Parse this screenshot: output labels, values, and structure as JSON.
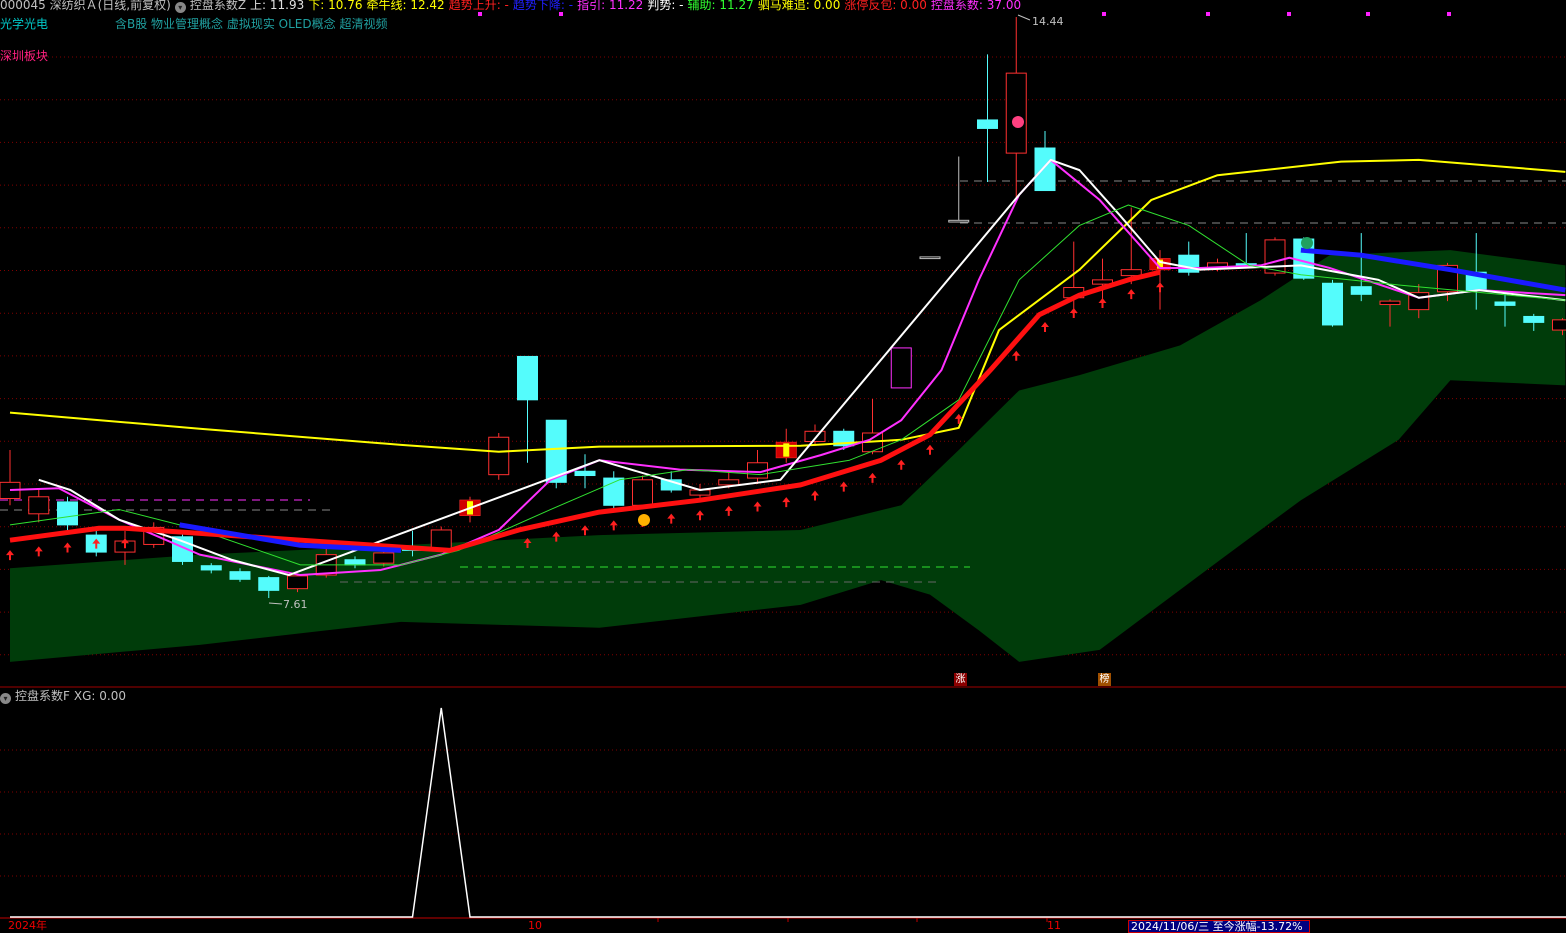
{
  "header": {
    "stock_code_name": "000045 深纺织Ａ",
    "period": "(日线,前复权)",
    "indicator_name": "控盘系数Z",
    "values": [
      {
        "label": "上: 11.93",
        "color": "#e0e0e0"
      },
      {
        "label": "下: 10.76",
        "color": "#ffff00"
      },
      {
        "label": "牵牛线: 12.42",
        "color": "#ffff00"
      },
      {
        "label": "趋势上升: -",
        "color": "#ff2020"
      },
      {
        "label": "趋势下降: -",
        "color": "#2020ff"
      },
      {
        "label": "指引: 11.22",
        "color": "#ff30ff"
      },
      {
        "label": "判势: -",
        "color": "#ffffff"
      },
      {
        "label": "辅助: 11.27",
        "color": "#30ff30"
      },
      {
        "label": "驷马难追: 0.00",
        "color": "#ffff00"
      },
      {
        "label": "涨停反包: 0.00",
        "color": "#ff2020"
      },
      {
        "label": "控盘系数: 37.00",
        "color": "#ff30ff"
      }
    ],
    "industry": "光学光电",
    "concepts": "含B股 物业管理概念 虚拟现实 OLED概念 超清视频",
    "region": "深圳板块"
  },
  "price_labels": {
    "high": "14.44",
    "low": "7.61"
  },
  "markers": {
    "limit_up": "涨",
    "ranking": "榜"
  },
  "sub_pane": {
    "indicator_name": "控盘系数F",
    "value_label": "XG: 0.00"
  },
  "x_axis": {
    "labels": [
      "2024年",
      "10",
      "11"
    ],
    "info": "2024/11/06/三 至今涨幅-13.72%"
  },
  "colors": {
    "up": "#ff3030",
    "down": "#54fcfc",
    "band": "#003c0a",
    "grid": "#800000"
  },
  "chart_data": {
    "type": "candlestick",
    "price_range": [
      6.6,
      14.6
    ],
    "candles": [
      [
        8.78,
        8.97,
        9.35,
        8.7
      ],
      [
        8.6,
        8.8,
        8.9,
        8.5
      ],
      [
        8.74,
        8.47,
        8.8,
        8.4
      ],
      [
        8.35,
        8.15,
        8.4,
        8.1
      ],
      [
        8.15,
        8.28,
        8.4,
        8.0
      ],
      [
        8.24,
        8.44,
        8.5,
        8.2
      ],
      [
        8.33,
        8.04,
        8.4,
        8.0
      ],
      [
        7.99,
        7.94,
        8.02,
        7.9
      ],
      [
        7.92,
        7.83,
        7.96,
        7.8
      ],
      [
        7.85,
        7.7,
        7.87,
        7.61
      ],
      [
        7.72,
        7.87,
        7.9,
        7.68
      ],
      [
        7.88,
        8.12,
        8.2,
        7.85
      ],
      [
        8.06,
        8.0,
        8.1,
        7.96
      ],
      [
        8.02,
        8.14,
        8.2,
        7.98
      ],
      [
        8.21,
        8.17,
        8.4,
        8.1
      ],
      [
        8.17,
        8.41,
        8.45,
        8.15
      ],
      [
        8.58,
        8.76,
        8.8,
        8.5
      ],
      [
        9.06,
        9.5,
        9.55,
        9.0
      ],
      [
        10.45,
        9.94,
        10.45,
        9.2
      ],
      [
        9.7,
        8.97,
        9.7,
        8.9
      ],
      [
        9.1,
        9.05,
        9.3,
        8.9
      ],
      [
        9.02,
        8.7,
        9.1,
        8.65
      ],
      [
        8.7,
        9.0,
        9.05,
        8.65
      ],
      [
        9.0,
        8.88,
        9.1,
        8.85
      ],
      [
        8.82,
        8.88,
        8.95,
        8.78
      ],
      [
        8.94,
        9.0,
        9.1,
        8.9
      ],
      [
        9.02,
        9.2,
        9.35,
        8.95
      ],
      [
        9.26,
        9.44,
        9.6,
        9.2
      ],
      [
        9.45,
        9.57,
        9.65,
        9.4
      ],
      [
        9.57,
        9.4,
        9.6,
        9.35
      ],
      [
        9.33,
        9.55,
        9.95,
        9.3
      ],
      [
        10.08,
        10.55,
        10.55,
        10.08
      ],
      [
        11.6,
        11.62,
        11.62,
        11.6
      ],
      [
        12.03,
        12.05,
        12.8,
        12.03
      ],
      [
        13.23,
        13.13,
        14.0,
        12.5
      ],
      [
        12.84,
        13.78,
        14.44,
        12.3
      ],
      [
        12.9,
        12.4,
        13.1,
        12.4
      ],
      [
        11.14,
        11.26,
        11.8,
        11.0
      ],
      [
        11.3,
        11.35,
        11.6,
        11.1
      ],
      [
        11.4,
        11.47,
        12.2,
        11.3
      ],
      [
        11.47,
        11.6,
        11.7,
        11.0
      ],
      [
        11.64,
        11.44,
        11.8,
        11.4
      ],
      [
        11.49,
        11.55,
        11.6,
        11.45
      ],
      [
        11.54,
        11.52,
        11.9,
        11.5
      ],
      [
        11.43,
        11.82,
        11.85,
        11.4
      ],
      [
        11.83,
        11.37,
        11.85,
        11.35
      ],
      [
        11.31,
        10.82,
        11.35,
        10.8
      ],
      [
        11.27,
        11.18,
        11.9,
        11.1
      ],
      [
        11.06,
        11.1,
        11.12,
        10.8
      ],
      [
        11.0,
        11.2,
        11.3,
        10.9
      ],
      [
        11.21,
        11.52,
        11.55,
        11.1
      ],
      [
        11.44,
        11.23,
        11.9,
        11.0
      ],
      [
        11.09,
        11.05,
        11.2,
        10.8
      ],
      [
        10.92,
        10.85,
        10.95,
        10.75
      ],
      [
        10.76,
        10.88,
        10.9,
        10.7
      ]
    ],
    "special_candles": {
      "yellow_marked": [
        16,
        27,
        40
      ],
      "magenta_box": [
        31
      ]
    },
    "series": [
      {
        "name": "牵牛线",
        "color": "#ffff00",
        "width": 2,
        "points": [
          [
            0,
            9.79
          ],
          [
            6.6,
            9.6
          ],
          [
            13.6,
            9.41
          ],
          [
            17,
            9.33
          ],
          [
            20.5,
            9.39
          ],
          [
            27.5,
            9.4
          ],
          [
            31,
            9.47
          ],
          [
            33,
            9.61
          ],
          [
            34.4,
            10.76
          ],
          [
            37.2,
            11.47
          ],
          [
            39.7,
            12.29
          ],
          [
            42,
            12.58
          ],
          [
            46.3,
            12.74
          ],
          [
            49,
            12.76
          ],
          [
            54.1,
            12.62
          ]
        ]
      },
      {
        "name": "指引",
        "color": "#ff30ff",
        "width": 2,
        "points": [
          [
            0,
            8.88
          ],
          [
            1.7,
            8.9
          ],
          [
            3.8,
            8.53
          ],
          [
            6.6,
            8.12
          ],
          [
            10.1,
            7.88
          ],
          [
            12.9,
            7.94
          ],
          [
            15,
            8.12
          ],
          [
            17,
            8.41
          ],
          [
            18.8,
            9.0
          ],
          [
            20.5,
            9.23
          ],
          [
            23.3,
            9.12
          ],
          [
            26.1,
            9.09
          ],
          [
            28.2,
            9.29
          ],
          [
            29.9,
            9.47
          ],
          [
            31,
            9.7
          ],
          [
            32.4,
            10.29
          ],
          [
            33.7,
            11.35
          ],
          [
            35.1,
            12.35
          ],
          [
            36.2,
            12.76
          ],
          [
            37.9,
            12.29
          ],
          [
            40,
            11.49
          ],
          [
            41.4,
            11.49
          ],
          [
            43.5,
            11.52
          ],
          [
            44.5,
            11.61
          ],
          [
            45.9,
            11.49
          ],
          [
            49,
            11.14
          ],
          [
            51.1,
            11.23
          ],
          [
            54.1,
            11.17
          ]
        ]
      },
      {
        "name": "判势",
        "color": "#ffffff",
        "width": 2,
        "points": [
          [
            1,
            9.0
          ],
          [
            2.1,
            8.88
          ],
          [
            3.8,
            8.53
          ],
          [
            5.9,
            8.29
          ],
          [
            7.7,
            8.06
          ],
          [
            9.7,
            7.88
          ],
          [
            20.5,
            9.23
          ],
          [
            24,
            8.88
          ],
          [
            26.8,
            9.0
          ],
          [
            35.1,
            12.35
          ],
          [
            36.2,
            12.76
          ],
          [
            37.2,
            12.64
          ],
          [
            38.6,
            12.11
          ],
          [
            40,
            11.56
          ],
          [
            41.4,
            11.47
          ],
          [
            44.9,
            11.52
          ],
          [
            47.6,
            11.35
          ],
          [
            49,
            11.14
          ],
          [
            51.1,
            11.23
          ],
          [
            54.1,
            11.11
          ]
        ]
      },
      {
        "name": "辅助",
        "color": "#30e030",
        "width": 1,
        "points": [
          [
            0,
            8.47
          ],
          [
            3.8,
            8.65
          ],
          [
            6.6,
            8.41
          ],
          [
            10.1,
            8.0
          ],
          [
            13.6,
            8.0
          ],
          [
            15.6,
            8.17
          ],
          [
            18.8,
            8.65
          ],
          [
            21.2,
            9.0
          ],
          [
            23.6,
            9.12
          ],
          [
            26.1,
            9.06
          ],
          [
            29.2,
            9.23
          ],
          [
            31,
            9.47
          ],
          [
            33,
            9.94
          ],
          [
            35.1,
            11.35
          ],
          [
            37.2,
            11.99
          ],
          [
            38.9,
            12.23
          ],
          [
            41,
            11.99
          ],
          [
            43.1,
            11.52
          ],
          [
            44.9,
            11.41
          ],
          [
            48.3,
            11.29
          ],
          [
            54.1,
            11.11
          ]
        ]
      },
      {
        "name": "趋势上升",
        "color": "#ff1010",
        "width": 5,
        "points": [
          [
            0,
            8.29
          ],
          [
            3.1,
            8.43
          ],
          [
            4,
            8.43
          ],
          [
            15.3,
            8.17
          ],
          [
            17.7,
            8.41
          ],
          [
            20.5,
            8.62
          ],
          [
            24,
            8.76
          ],
          [
            27.5,
            8.94
          ],
          [
            30.3,
            9.23
          ],
          [
            32,
            9.53
          ],
          [
            34.1,
            10.29
          ],
          [
            35.8,
            10.94
          ],
          [
            37.2,
            11.17
          ],
          [
            38.9,
            11.35
          ],
          [
            40,
            11.44
          ]
        ]
      },
      {
        "name": "趋势下降A",
        "color": "#1a1aff",
        "width": 5,
        "points": [
          [
            5.9,
            8.47
          ],
          [
            10.1,
            8.23
          ],
          [
            13.6,
            8.17
          ]
        ]
      },
      {
        "name": "趋势下降B",
        "color": "#1a1aff",
        "width": 5,
        "points": [
          [
            44.9,
            11.7
          ],
          [
            47,
            11.64
          ],
          [
            50.1,
            11.47
          ],
          [
            54.1,
            11.23
          ]
        ]
      }
    ],
    "band": {
      "upper": [
        [
          0,
          7.96
        ],
        [
          6.6,
          8.12
        ],
        [
          13.6,
          8.23
        ],
        [
          20.5,
          8.35
        ],
        [
          27.5,
          8.41
        ],
        [
          31,
          8.7
        ],
        [
          33,
          9.35
        ],
        [
          35.1,
          10.05
        ],
        [
          37.2,
          10.23
        ],
        [
          40.7,
          10.58
        ],
        [
          43.5,
          11.11
        ],
        [
          45.9,
          11.64
        ],
        [
          50.1,
          11.7
        ],
        [
          54.1,
          11.52
        ]
      ],
      "lower": [
        [
          0,
          6.86
        ],
        [
          6.6,
          7.06
        ],
        [
          13.6,
          7.33
        ],
        [
          20.5,
          7.26
        ],
        [
          27.5,
          7.53
        ],
        [
          30.3,
          7.82
        ],
        [
          32,
          7.65
        ],
        [
          33.7,
          7.23
        ],
        [
          35.1,
          6.86
        ],
        [
          37.9,
          7.0
        ],
        [
          42.1,
          8.06
        ],
        [
          44.9,
          8.76
        ],
        [
          48.3,
          9.47
        ],
        [
          50.1,
          10.17
        ],
        [
          54.1,
          10.11
        ]
      ]
    },
    "up_arrows": [
      0,
      1,
      2,
      3,
      4,
      18,
      19,
      20,
      21,
      22,
      23,
      24,
      25,
      26,
      27,
      28,
      29,
      30,
      31,
      32,
      33,
      35,
      36,
      37,
      38,
      39,
      40
    ],
    "sub_indicator": {
      "name": "XG",
      "range": [
        0,
        1
      ],
      "spike_index": 15,
      "values_note_len": 55
    }
  }
}
